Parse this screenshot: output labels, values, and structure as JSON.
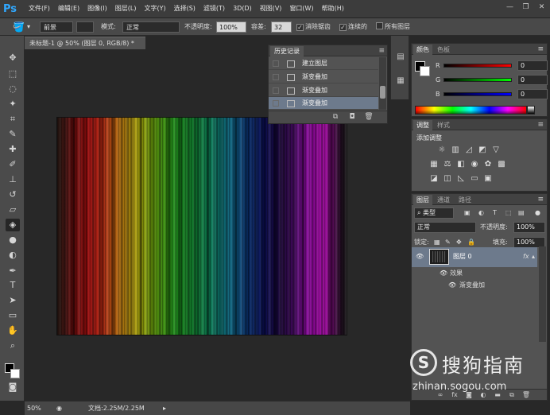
{
  "app": {
    "logo": "Ps",
    "menu": [
      "文件(F)",
      "编辑(E)",
      "图像(I)",
      "图层(L)",
      "文字(Y)",
      "选择(S)",
      "滤镜(T)",
      "3D(D)",
      "视图(V)",
      "窗口(W)",
      "帮助(H)"
    ],
    "window_buttons": [
      "—",
      "❐",
      "✕"
    ]
  },
  "options": {
    "preset": "前景",
    "mode_label": "模式:",
    "mode_value": "正常",
    "opacity_label": "不透明度:",
    "opacity_value": "100%",
    "tolerance_label": "容差:",
    "tolerance_value": "32",
    "antialias_label": "消除锯齿",
    "contiguous_label": "连续的",
    "all_layers_label": "所有图层"
  },
  "document": {
    "tab_title": "未标题-1 @ 50% (图层 0, RGB/8) *",
    "zoom": "50%",
    "doc_info": "文档:2.25M/2.25M"
  },
  "history": {
    "title": "历史记录",
    "items": [
      "建立图层",
      "渐变叠加",
      "渐变叠加",
      "渐变叠加"
    ],
    "selected_index": 3
  },
  "color_panel": {
    "tabs": [
      "颜色",
      "色板"
    ],
    "channels": [
      {
        "label": "R",
        "value": "0",
        "color": "#ff0000"
      },
      {
        "label": "G",
        "value": "0",
        "color": "#00ff00"
      },
      {
        "label": "B",
        "value": "0",
        "color": "#0000ff"
      }
    ]
  },
  "adjustments_panel": {
    "tabs": [
      "调整",
      "样式"
    ],
    "title": "添加调整"
  },
  "layers_panel": {
    "tabs": [
      "图层",
      "通道",
      "路径"
    ],
    "filter_kind": "类型",
    "blend_mode": "正常",
    "opacity_label": "不透明度:",
    "opacity_value": "100%",
    "lock_label": "锁定:",
    "fill_label": "填充:",
    "fill_value": "100%",
    "layer_name": "图层 0",
    "fx_badge": "fx",
    "effects_label": "效果",
    "effect_item": "渐变叠加"
  },
  "watermark": {
    "logo_char": "S",
    "brand": "搜狗指南",
    "url": "zhinan.sogou.com"
  },
  "colors": {
    "accent_selection": "#6d7a8c",
    "panel_bg": "#535353",
    "canvas_bg": "#282828"
  }
}
